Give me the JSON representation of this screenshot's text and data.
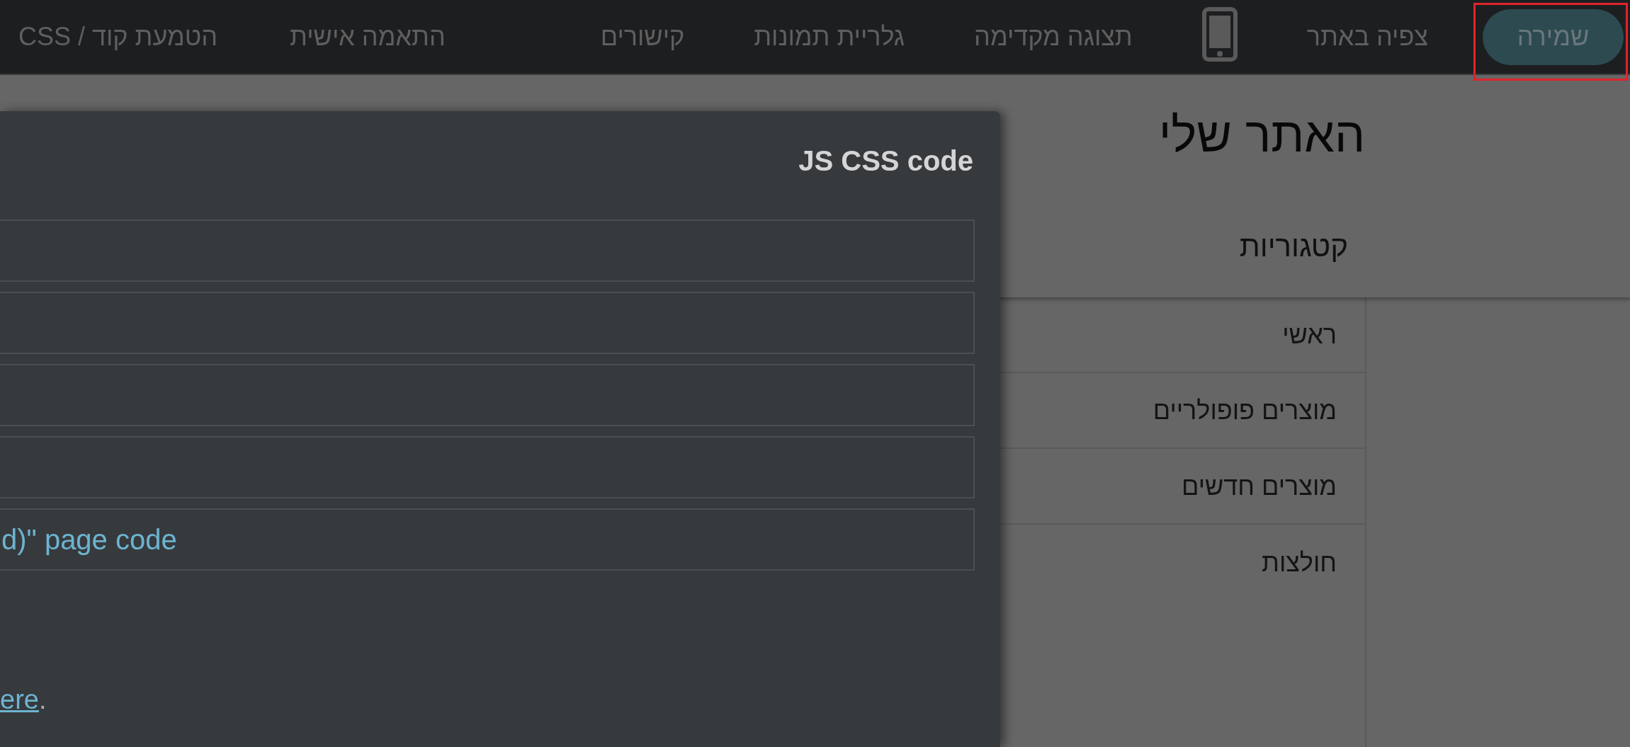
{
  "toolbar": {
    "items": [
      {
        "kind": "button",
        "label": "שמירה",
        "highlighted": true
      },
      {
        "kind": "link",
        "label": "צפיה באתר",
        "highlighted": false
      },
      {
        "kind": "icon",
        "highlighted": false
      },
      {
        "kind": "link",
        "label": "תצוגה מקדימה",
        "highlighted": false
      },
      {
        "kind": "link",
        "label": "גלריית תמונות",
        "highlighted": false
      },
      {
        "kind": "link",
        "label": "קישורים",
        "highlighted": false
      }
    ],
    "end_items": [
      {
        "kind": "link",
        "label": "התאמה אישית",
        "highlighted": false
      },
      {
        "kind": "link",
        "label": "הטמעת קוד / CSS",
        "highlighted": false
      }
    ]
  },
  "dialog": {
    "title": "JS CSS code",
    "options": [
      {
        "kind": "blank"
      },
      {
        "kind": "blank"
      },
      {
        "kind": "blank"
      },
      {
        "kind": "blank"
      },
      {
        "kind": "text",
        "label": "d)\" page code"
      }
    ],
    "note": {
      "link": "ere",
      "after": "."
    }
  },
  "site": {
    "title": "האתר שלי",
    "section_heading": "קטגוריות",
    "menu": [
      {
        "label": "ראשי"
      },
      {
        "label": "מוצרים פופולריים"
      },
      {
        "label": "מוצרים חדשים"
      },
      {
        "label": "חולצות"
      }
    ]
  }
}
